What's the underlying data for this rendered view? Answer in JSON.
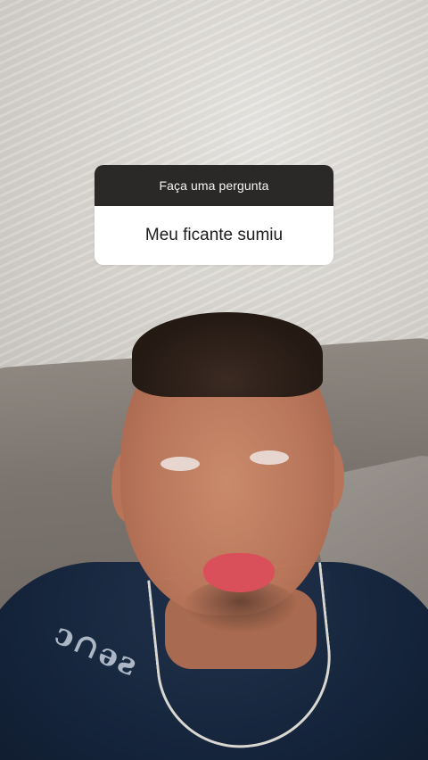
{
  "question_sticker": {
    "header": "Faça uma pergunta",
    "answer": "Meu ficante sumiu"
  }
}
